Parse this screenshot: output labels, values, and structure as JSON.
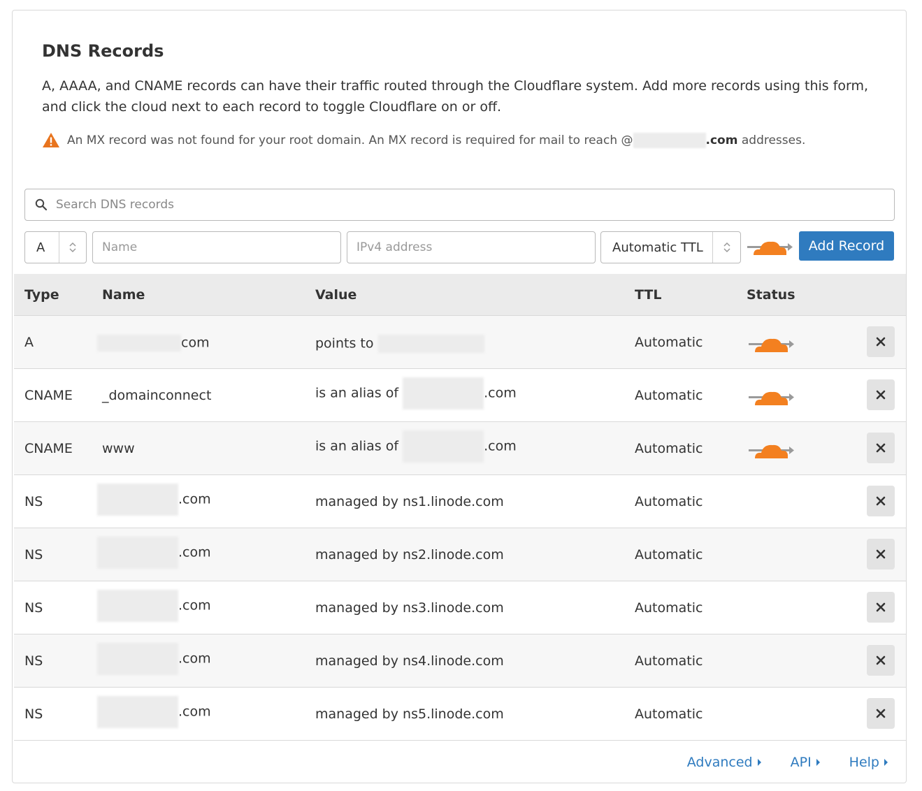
{
  "header": {
    "title": "DNS Records",
    "description": "A, AAAA, and CNAME records can have their traffic routed through the Cloudflare system. Add more records using this form, and click the cloud next to each record to toggle Cloudflare on or off.",
    "warning_prefix": "An MX record was not found for your root domain. An MX record is required for mail to reach @",
    "warning_domain": ".com",
    "warning_suffix": " addresses."
  },
  "search": {
    "placeholder": "Search DNS records"
  },
  "add_form": {
    "type_value": "A",
    "name_placeholder": "Name",
    "value_placeholder": "IPv4 address",
    "ttl_value": "Automatic TTL",
    "add_button": "Add Record"
  },
  "table": {
    "columns": [
      "Type",
      "Name",
      "Value",
      "TTL",
      "Status"
    ],
    "rows": [
      {
        "type": "A",
        "name": "com",
        "value_prefix": "points to",
        "value": "",
        "ttl": "Automatic",
        "proxied": true
      },
      {
        "type": "CNAME",
        "name": "_domainconnect",
        "value_prefix": "is an alias of",
        "value": ".com",
        "ttl": "Automatic",
        "proxied": true
      },
      {
        "type": "CNAME",
        "name": "www",
        "value_prefix": "is an alias of",
        "value": ".com",
        "ttl": "Automatic",
        "proxied": true
      },
      {
        "type": "NS",
        "name": ".com",
        "value_prefix": "managed by",
        "value": "ns1.linode.com",
        "ttl": "Automatic",
        "proxied": false
      },
      {
        "type": "NS",
        "name": ".com",
        "value_prefix": "managed by",
        "value": "ns2.linode.com",
        "ttl": "Automatic",
        "proxied": false
      },
      {
        "type": "NS",
        "name": ".com",
        "value_prefix": "managed by",
        "value": "ns3.linode.com",
        "ttl": "Automatic",
        "proxied": false
      },
      {
        "type": "NS",
        "name": ".com",
        "value_prefix": "managed by",
        "value": "ns4.linode.com",
        "ttl": "Automatic",
        "proxied": false
      },
      {
        "type": "NS",
        "name": ".com",
        "value_prefix": "managed by",
        "value": "ns5.linode.com",
        "ttl": "Automatic",
        "proxied": false
      }
    ]
  },
  "footer": {
    "links": [
      "Advanced",
      "API",
      "Help"
    ]
  },
  "colors": {
    "accent": "#2f7bbf",
    "cloud": "#f38020",
    "warning": "#e8741e",
    "header_bg": "#ebebeb"
  },
  "icons": {
    "search": "search-icon",
    "warning": "warning-icon",
    "cloud": "cloud-proxy-icon",
    "delete": "close-icon"
  }
}
